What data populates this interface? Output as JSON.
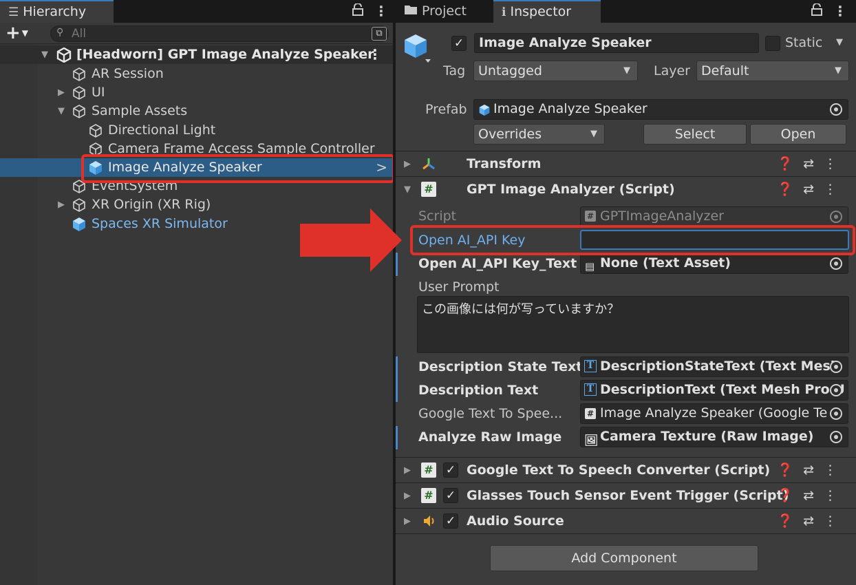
{
  "hierarchy": {
    "tab_label": "Hierarchy",
    "search_placeholder": "All",
    "scene_name": "[Headworn] GPT Image Analyze Speaker",
    "items": [
      {
        "label": "AR Session"
      },
      {
        "label": "UI"
      },
      {
        "label": "Sample Assets"
      },
      {
        "label": "Directional Light"
      },
      {
        "label": "Camera Frame Access Sample Controller"
      },
      {
        "label": "Image Analyze Speaker"
      },
      {
        "label": "EventSystem"
      },
      {
        "label": "XR Origin (XR Rig)"
      },
      {
        "label": "Spaces XR Simulator"
      }
    ]
  },
  "inspector": {
    "tabs": [
      {
        "label": "Project"
      },
      {
        "label": "Inspector"
      }
    ],
    "object_name": "Image Analyze Speaker",
    "static_label": "Static",
    "tag_label": "Tag",
    "tag_value": "Untagged",
    "layer_label": "Layer",
    "layer_value": "Default",
    "prefab_label": "Prefab",
    "prefab_value": "Image Analyze Speaker",
    "overrides_label": "Overrides",
    "select_label": "Select",
    "open_label": "Open",
    "components": {
      "transform": "Transform",
      "gpt": "GPT Image Analyzer (Script)",
      "tts": "Google Text To Speech Converter (Script)",
      "touch": "Glasses Touch Sensor Event Trigger (Script)",
      "audio": "Audio Source"
    },
    "gpt_props": {
      "script_label": "Script",
      "script_value": "GPTImageAnalyzer",
      "api_key_label": "Open AI_API Key",
      "api_key_value": "",
      "api_key_text_label": "Open AI_API Key_Text",
      "api_key_text_value": "None (Text Asset)",
      "user_prompt_label": "User Prompt",
      "user_prompt_value": "この画像には何が写っていますか？",
      "desc_state_label": "Description State Text",
      "desc_state_value": "DescriptionStateText (Text Mesh",
      "desc_text_label": "Description Text",
      "desc_text_value": "DescriptionText (Text Mesh Pro U",
      "tts_ref_label": "Google Text To Spee...",
      "tts_ref_value": "Image Analyze Speaker (Google Te",
      "raw_image_label": "Analyze Raw Image",
      "raw_image_value": "Camera Texture (Raw Image)"
    },
    "add_component_label": "Add Component"
  },
  "colors": {
    "selection": "#2c5d87",
    "accent_blue": "#4b88c9",
    "annotation_red": "#e0302a",
    "prefab_blue": "#7eb8f0"
  }
}
